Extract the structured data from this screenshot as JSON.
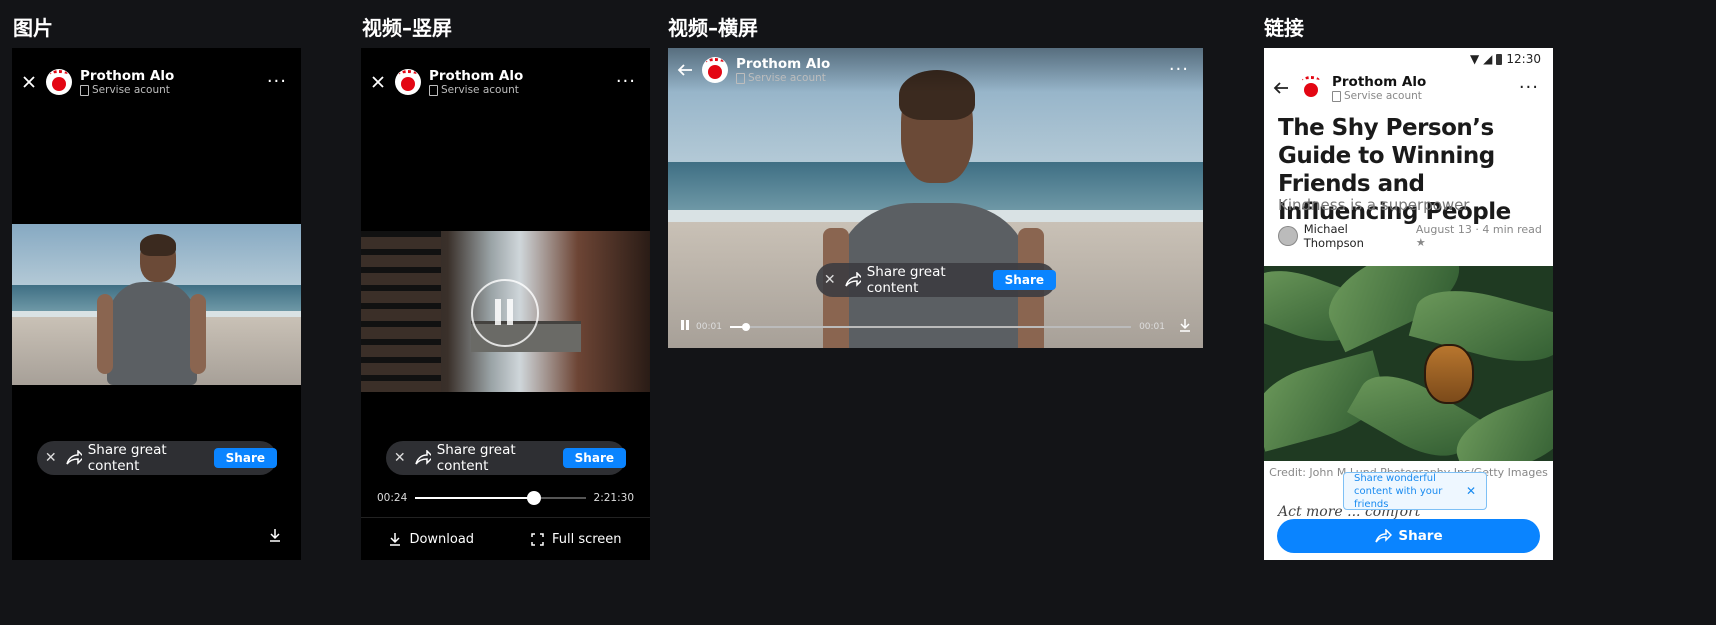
{
  "sections": [
    {
      "title": "图片"
    },
    {
      "title": "视频–竖屏"
    },
    {
      "title": "视频–横屏"
    },
    {
      "title": "链接"
    }
  ],
  "account": {
    "name": "Prothom Alo",
    "subtitle": "Servise acount"
  },
  "share_bar": {
    "text": "Share great content",
    "button": "Share"
  },
  "portrait_video": {
    "elapsed": "00:24",
    "duration": "2:21:30",
    "progress": 0.7,
    "download_label": "Download",
    "fullscreen_label": "Full screen"
  },
  "landscape_video": {
    "elapsed": "00:01",
    "remaining": "00:01",
    "progress": 0.04
  },
  "link": {
    "status_time": "12:30",
    "title": "The Shy Person’s Guide to Winning Friends and Influencing People",
    "subtitle": "Kindness is a superpower",
    "author": "Michael Thompson",
    "meta": "August 13 · 4 min read ★",
    "credit": "Credit: John M Lund Photography Inc/Getty Images",
    "body_snippet": "Act more ... comfort",
    "tooltip": "Share wonderful content with your friends",
    "share_button": "Share"
  },
  "colors": {
    "background": "#131417",
    "accent": "#0a84ff",
    "brand_red": "#e30613"
  }
}
